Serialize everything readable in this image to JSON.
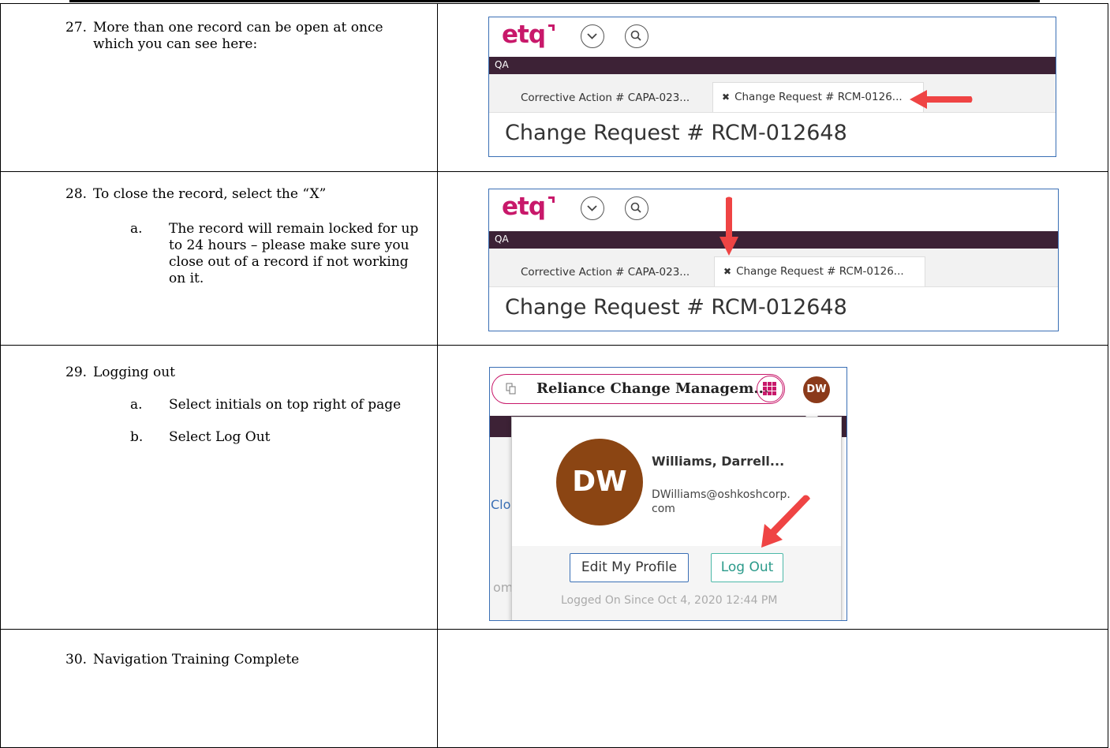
{
  "steps": [
    {
      "num": "27.",
      "text": "More than one record can be open at once which you can see here:"
    },
    {
      "num": "28.",
      "text": "To close the record, select the “X”",
      "subs": [
        {
          "letter": "a.",
          "text": "The record will remain locked for up to 24 hours – please make sure you close out of a record if not working on it."
        }
      ]
    },
    {
      "num": "29.",
      "text": "Logging out",
      "subs": [
        {
          "letter": "a.",
          "text": "Select initials on top right of page"
        },
        {
          "letter": "b.",
          "text": "Select Log Out"
        }
      ]
    },
    {
      "num": "30.",
      "text": "Navigation Training Complete"
    }
  ],
  "etq": {
    "logo": "etq",
    "band_label": "QA",
    "tab_inactive": "Corrective Action # CAPA-023...",
    "tab_active": "Change Request # RCM-0126...",
    "tab_close_glyph": "✖",
    "record_title": "Change Request # RCM-012648",
    "arrow_color": "#ef4444",
    "brand_color": "#c8186a"
  },
  "logout_panel": {
    "app_name": "Reliance Change Managem...",
    "initials": "DW",
    "user_name": "Williams, Darrell...",
    "user_email": "DWilliams@oshkoshcorp.com",
    "edit_profile": "Edit My Profile",
    "log_out": "Log Out",
    "logged_on": "Logged On Since Oct 4, 2020 12:44 PM",
    "behind_text_1": "Clos",
    "behind_text_2": "om"
  }
}
